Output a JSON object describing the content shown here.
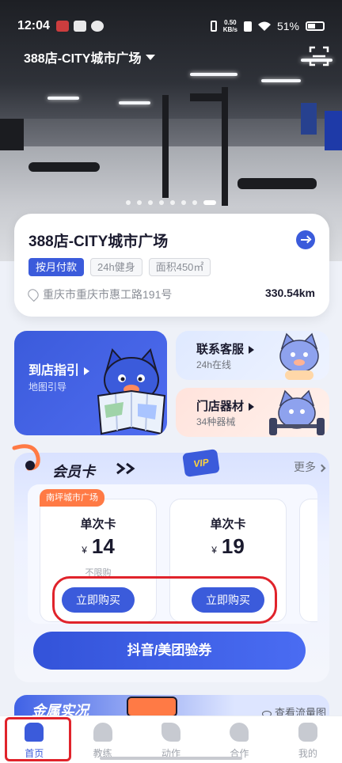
{
  "status_bar": {
    "time": "12:04",
    "net_speed": "0.50",
    "net_unit": "KB/s",
    "battery": "51%"
  },
  "header": {
    "store_selector": "388店-CITY城市广场",
    "scan_icon": "scan-icon"
  },
  "carousel": {
    "count": 8,
    "active_index": 7
  },
  "store_card": {
    "name": "388店-CITY城市广场",
    "tags": [
      "按月付款",
      "24h健身",
      "面积450㎡"
    ],
    "address": "重庆市重庆市惠工路191号",
    "distance": "330.54km"
  },
  "tiles": {
    "guide": {
      "title": "到店指引",
      "subtitle": "地图引导"
    },
    "service": {
      "title": "联系客服",
      "subtitle": "24h在线"
    },
    "equipment": {
      "title": "门店器材",
      "subtitle": "34种器械"
    }
  },
  "member": {
    "title": "会员卡",
    "badge": "VIP",
    "more": "更多",
    "store_badge": "南坪城市广场",
    "cards": [
      {
        "title": "单次卡",
        "currency": "¥",
        "price": "14",
        "limit": "不限购",
        "buy": "立即购买"
      },
      {
        "title": "单次卡",
        "currency": "¥",
        "price": "19",
        "limit": "",
        "buy": "立即购买"
      }
    ],
    "voucher": "抖音/美团验券"
  },
  "next_section": {
    "title": "金属实况",
    "link": "查看流量图"
  },
  "nav": {
    "items": [
      {
        "label": "首页",
        "icon": "home-icon",
        "active": true
      },
      {
        "label": "教练",
        "icon": "coach-icon",
        "active": false
      },
      {
        "label": "动作",
        "icon": "exercise-icon",
        "active": false
      },
      {
        "label": "合作",
        "icon": "partnership-icon",
        "active": false
      },
      {
        "label": "我的",
        "icon": "profile-icon",
        "active": false
      }
    ]
  },
  "colors": {
    "primary": "#3b5bdb",
    "accent_orange": "#ff7a45",
    "highlight_red": "#e0232b"
  }
}
